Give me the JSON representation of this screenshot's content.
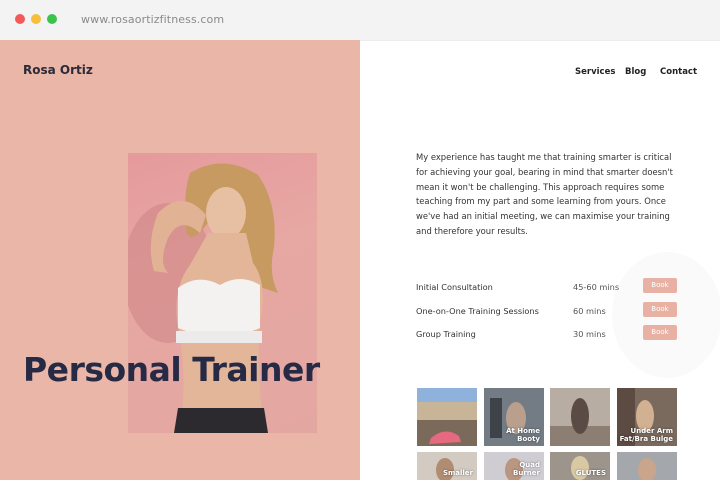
{
  "browser": {
    "url": "www.rosaortizfitness.com"
  },
  "header": {
    "brand": "Rosa Ortiz",
    "nav": [
      "Services",
      "Blog",
      "Contact"
    ]
  },
  "hero": {
    "title": "Personal Trainer"
  },
  "intro": {
    "text": "My experience has taught me that training smarter is critical for achieving your goal, bearing in mind that smarter doesn't mean it won't be challenging. This approach requires some teaching from my part and some learning from yours. Once we've had an initial meeting, we can maximise your training and therefore your results."
  },
  "services": [
    {
      "name": "Initial Consultation",
      "duration": "45-60 mins",
      "action": "Book"
    },
    {
      "name": "One-on-One Training Sessions",
      "duration": "60 mins",
      "action": "Book"
    },
    {
      "name": "Group Training",
      "duration": "30 mins",
      "action": "Book"
    }
  ],
  "gallery": [
    {
      "caption": ""
    },
    {
      "caption": "At Home\nBooty"
    },
    {
      "caption": ""
    },
    {
      "caption": "Under Arm\nFat/Bra Bulge"
    },
    {
      "caption": "Smaller"
    },
    {
      "caption": "Quad\nBurner"
    },
    {
      "caption": "GLUTES"
    },
    {
      "caption": ""
    }
  ],
  "colors": {
    "hero_bg": "#e9b6a8",
    "title": "#262a44",
    "button": "#e9b1a3"
  }
}
